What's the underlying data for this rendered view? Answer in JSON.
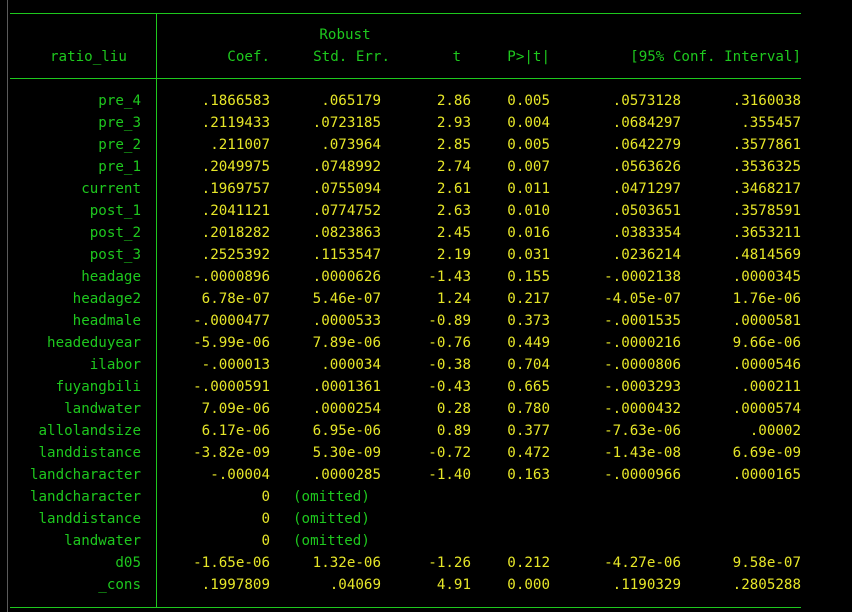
{
  "colors": {
    "background": "#000000",
    "rules": "#1ec81e",
    "labels": "#1ec81e",
    "results": "#e6e628"
  },
  "table": {
    "header": {
      "depvar": "ratio_liu",
      "robust": "Robust",
      "coef": "Coef.",
      "se": "Std. Err.",
      "t": "t",
      "p": "P>|t|",
      "ci": "[95% Conf. Interval]"
    },
    "rows": [
      {
        "var": "pre_4",
        "coef": ".1866583",
        "se": ".065179",
        "t": "2.86",
        "p": "0.005",
        "lo": ".0573128",
        "hi": ".3160038"
      },
      {
        "var": "pre_3",
        "coef": ".2119433",
        "se": ".0723185",
        "t": "2.93",
        "p": "0.004",
        "lo": ".0684297",
        "hi": ".355457"
      },
      {
        "var": "pre_2",
        "coef": ".211007",
        "se": ".073964",
        "t": "2.85",
        "p": "0.005",
        "lo": ".0642279",
        "hi": ".3577861"
      },
      {
        "var": "pre_1",
        "coef": ".2049975",
        "se": ".0748992",
        "t": "2.74",
        "p": "0.007",
        "lo": ".0563626",
        "hi": ".3536325"
      },
      {
        "var": "current",
        "coef": ".1969757",
        "se": ".0755094",
        "t": "2.61",
        "p": "0.011",
        "lo": ".0471297",
        "hi": ".3468217"
      },
      {
        "var": "post_1",
        "coef": ".2041121",
        "se": ".0774752",
        "t": "2.63",
        "p": "0.010",
        "lo": ".0503651",
        "hi": ".3578591"
      },
      {
        "var": "post_2",
        "coef": ".2018282",
        "se": ".0823863",
        "t": "2.45",
        "p": "0.016",
        "lo": ".0383354",
        "hi": ".3653211"
      },
      {
        "var": "post_3",
        "coef": ".2525392",
        "se": ".1153547",
        "t": "2.19",
        "p": "0.031",
        "lo": ".0236214",
        "hi": ".4814569"
      },
      {
        "var": "headage",
        "coef": "-.0000896",
        "se": ".0000626",
        "t": "-1.43",
        "p": "0.155",
        "lo": "-.0002138",
        "hi": ".0000345"
      },
      {
        "var": "headage2",
        "coef": "6.78e-07",
        "se": "5.46e-07",
        "t": "1.24",
        "p": "0.217",
        "lo": "-4.05e-07",
        "hi": "1.76e-06"
      },
      {
        "var": "headmale",
        "coef": "-.0000477",
        "se": ".0000533",
        "t": "-0.89",
        "p": "0.373",
        "lo": "-.0001535",
        "hi": ".0000581"
      },
      {
        "var": "headeduyear",
        "coef": "-5.99e-06",
        "se": "7.89e-06",
        "t": "-0.76",
        "p": "0.449",
        "lo": "-.0000216",
        "hi": "9.66e-06"
      },
      {
        "var": "ilabor",
        "coef": "-.000013",
        "se": ".000034",
        "t": "-0.38",
        "p": "0.704",
        "lo": "-.0000806",
        "hi": ".0000546"
      },
      {
        "var": "fuyangbili",
        "coef": "-.0000591",
        "se": ".0001361",
        "t": "-0.43",
        "p": "0.665",
        "lo": "-.0003293",
        "hi": ".000211"
      },
      {
        "var": "landwater",
        "coef": "7.09e-06",
        "se": ".0000254",
        "t": "0.28",
        "p": "0.780",
        "lo": "-.0000432",
        "hi": ".0000574"
      },
      {
        "var": "allolandsize",
        "coef": "6.17e-06",
        "se": "6.95e-06",
        "t": "0.89",
        "p": "0.377",
        "lo": "-7.63e-06",
        "hi": ".00002"
      },
      {
        "var": "landdistance",
        "coef": "-3.82e-09",
        "se": "5.30e-09",
        "t": "-0.72",
        "p": "0.472",
        "lo": "-1.43e-08",
        "hi": "6.69e-09"
      },
      {
        "var": "landcharacter",
        "coef": "-.00004",
        "se": ".0000285",
        "t": "-1.40",
        "p": "0.163",
        "lo": "-.0000966",
        "hi": ".0000165"
      },
      {
        "var": "landcharacter",
        "coef": "0",
        "se": "(omitted)",
        "t": "",
        "p": "",
        "lo": "",
        "hi": ""
      },
      {
        "var": "landdistance",
        "coef": "0",
        "se": "(omitted)",
        "t": "",
        "p": "",
        "lo": "",
        "hi": ""
      },
      {
        "var": "landwater",
        "coef": "0",
        "se": "(omitted)",
        "t": "",
        "p": "",
        "lo": "",
        "hi": ""
      },
      {
        "var": "d05",
        "coef": "-1.65e-06",
        "se": "1.32e-06",
        "t": "-1.26",
        "p": "0.212",
        "lo": "-4.27e-06",
        "hi": "9.58e-07"
      },
      {
        "var": "_cons",
        "coef": ".1997809",
        "se": ".04069",
        "t": "4.91",
        "p": "0.000",
        "lo": ".1190329",
        "hi": ".2805288"
      }
    ]
  }
}
